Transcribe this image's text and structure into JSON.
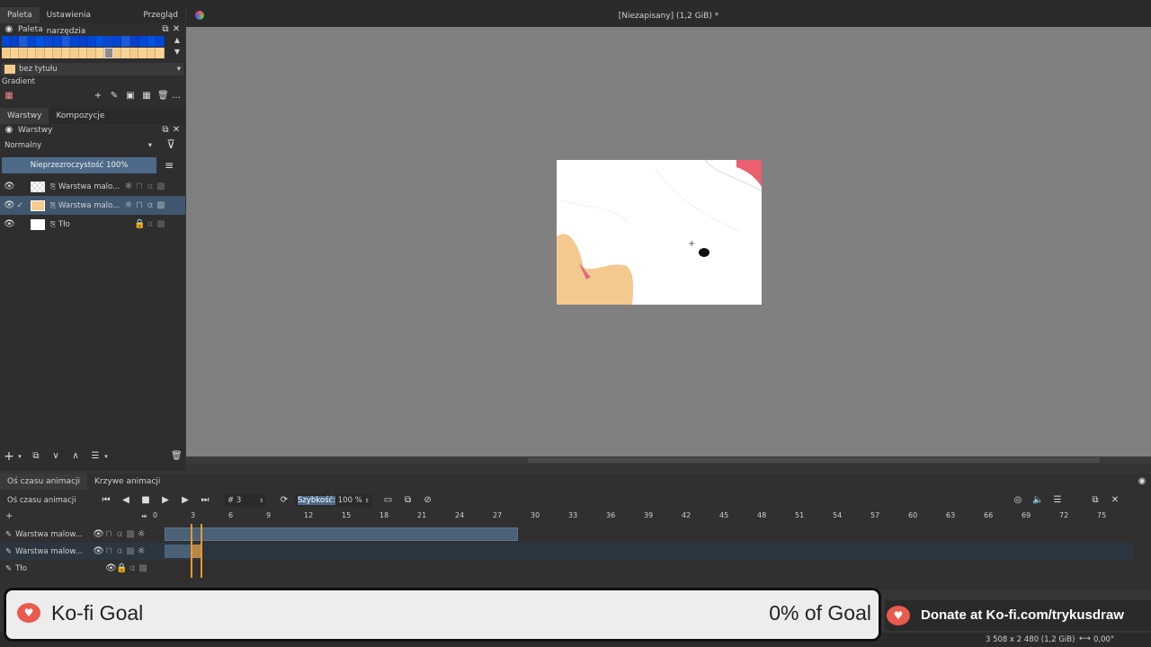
{
  "sidebar_tabs": [
    "Paleta",
    "Ustawienia narzędzia",
    "Przegląd"
  ],
  "palette": {
    "title": "Paleta",
    "name": "bez tytułu",
    "gradient_label": "Gradient",
    "colors": [
      "#0047d6",
      "#0a3fc8",
      "#1d5ad8"
    ]
  },
  "layers_tabs": [
    "Warstwy",
    "Kompozycje"
  ],
  "layers": {
    "title": "Warstwy",
    "blend_mode": "Normalny",
    "opacity_label": "Nieprzezroczystość",
    "opacity_value": "100%",
    "items": [
      {
        "name": "Warstwa malo..."
      },
      {
        "name": "Warstwa malo...",
        "check": "✓"
      },
      {
        "name": "Tło"
      }
    ]
  },
  "document": {
    "title": "[Niezapisany]  (1,2 GiB) *"
  },
  "timeline": {
    "tabs": [
      "Oś czasu animacji",
      "Krzywe animacji"
    ],
    "label": "Oś czasu animacji",
    "frame_prefix": "#",
    "frame": "3",
    "speed_label": "Szybkość:",
    "speed_value": "100 %",
    "ruler": [
      "0",
      "3",
      "6",
      "9",
      "12",
      "15",
      "18",
      "21",
      "24",
      "27",
      "30",
      "33",
      "36",
      "39",
      "42",
      "45",
      "48",
      "51",
      "54",
      "57",
      "60",
      "63",
      "66",
      "69",
      "72",
      "75"
    ],
    "tracks": [
      "Warstwa malow...",
      "Warstwa malow...",
      "Tło"
    ]
  },
  "banner": {
    "title": "Ko-fi Goal",
    "goal": "0% of Goal",
    "donate": "Donate at Ko-fi.com/trykusdraw"
  },
  "status": {
    "dimensions": "3 508 x 2 480 (1,2 GiB)",
    "rotation": "0,00°"
  }
}
